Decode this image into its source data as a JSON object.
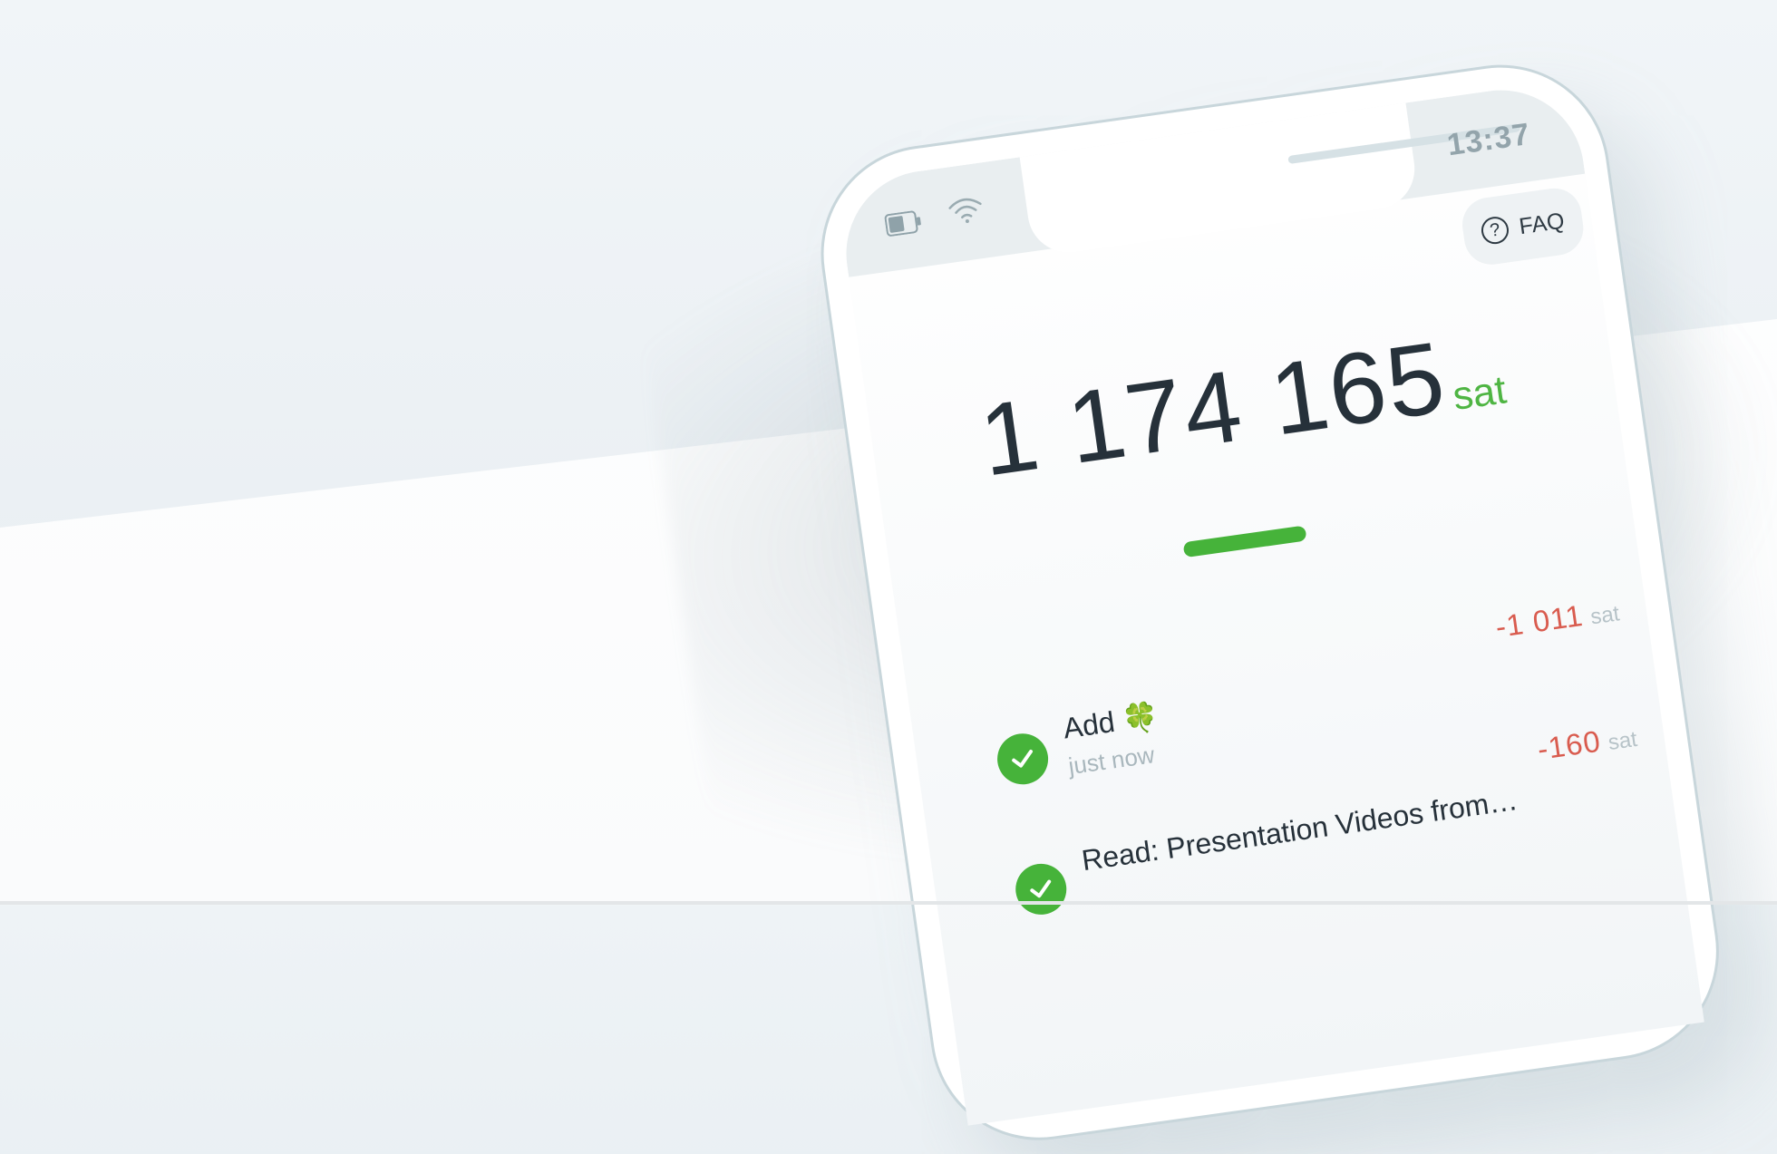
{
  "status_bar": {
    "time": "13:37",
    "battery_icon": "battery-icon",
    "wifi_icon": "wifi-icon"
  },
  "faq": {
    "label": "FAQ",
    "icon": "help-circle-icon",
    "icon_glyph": "?"
  },
  "balance": {
    "amount": "1 174 165",
    "unit": "sat"
  },
  "transactions": [
    {
      "title": "Add 🍀",
      "time": "just now",
      "amount": "-1 011",
      "unit": "sat",
      "status": "completed"
    },
    {
      "title": "Read: Presentation Videos from…",
      "time": "",
      "amount": "-160",
      "unit": "sat",
      "status": "completed"
    }
  ],
  "colors": {
    "accent_green": "#46b33a",
    "amount_red": "#d95c4f",
    "text_dark": "#26313a",
    "muted": "#a9b7bd"
  }
}
